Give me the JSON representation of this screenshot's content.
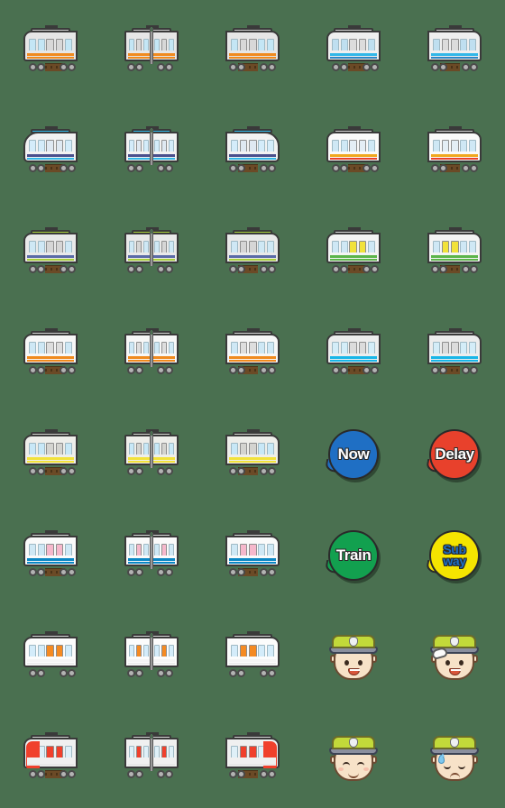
{
  "sheet": {
    "title": "Train Emoji Sticker Sheet",
    "background_color": "#4a7050",
    "columns": 5,
    "rows": 8
  },
  "palette": {
    "background": "#4a7050",
    "outline": "#3a3a3a",
    "body_silver": "#e6e6e6",
    "window_blue": "#c4e6f5",
    "rail_brown": "#6b4a26",
    "wheel_gray": "#b3b3b3",
    "orange": "#f08a1e",
    "sky_blue": "#31b7e8",
    "deep_blue": "#1f6fc4",
    "red": "#e8412c",
    "green": "#5cb54a",
    "yellow": "#f2e23a",
    "pink": "#f6b8cc",
    "cap_green": "#c2d93a",
    "skin": "#f7e2c8"
  },
  "cells": [
    {
      "id": "r1c1",
      "kind": "train",
      "name": "orange-stripe-train-front-left",
      "body": "#e6e6e6",
      "stripe": "#f08a1e",
      "stripe2": "#f08a1e",
      "roof": "#c9c9c9",
      "variant": "nose-left",
      "coupled": false,
      "door_color": "#d8d8d8",
      "window": "#c4e6f5",
      "rail": true
    },
    {
      "id": "r1c2",
      "kind": "train",
      "name": "orange-stripe-train-coupled",
      "body": "#e6e6e6",
      "stripe": "#f08a1e",
      "stripe2": "#f08a1e",
      "roof": "#c9c9c9",
      "variant": "coupled",
      "coupled": true,
      "door_color": "#d8d8d8",
      "window": "#c4e6f5",
      "rail": false
    },
    {
      "id": "r1c3",
      "kind": "train",
      "name": "orange-stripe-train-front-right",
      "body": "#e6e6e6",
      "stripe": "#f08a1e",
      "stripe2": "#f08a1e",
      "roof": "#c9c9c9",
      "variant": "nose-right",
      "coupled": false,
      "door_color": "#d8d8d8",
      "window": "#c4e6f5",
      "rail": true
    },
    {
      "id": "r1c4",
      "kind": "train",
      "name": "blue-stripe-commuter-train-left",
      "body": "#efefef",
      "stripe": "#31b7e8",
      "stripe2": "#2f86c4",
      "roof": "#cfcfcf",
      "variant": "nose-left",
      "coupled": false,
      "door_color": "#dcdcdc",
      "window": "#bfdff0",
      "rail": true
    },
    {
      "id": "r1c5",
      "kind": "train",
      "name": "blue-stripe-commuter-train-right",
      "body": "#efefef",
      "stripe": "#31b7e8",
      "stripe2": "#2f86c4",
      "roof": "#cfcfcf",
      "variant": "nose-right",
      "coupled": false,
      "door_color": "#dcdcdc",
      "window": "#bfdff0",
      "rail": true
    },
    {
      "id": "r2c1",
      "kind": "train",
      "name": "sleek-blue-roof-train-left",
      "body": "#f2f2f2",
      "stripe": "#4a4f8c",
      "stripe2": "#31b7e8",
      "roof": "#31b7e8",
      "variant": "nose-left",
      "coupled": false,
      "sleek": true,
      "door_color": "#dfe9f2",
      "window": "#d4ecfa",
      "rail": true
    },
    {
      "id": "r2c2",
      "kind": "train",
      "name": "sleek-blue-roof-train-coupled",
      "body": "#f2f2f2",
      "stripe": "#4a4f8c",
      "stripe2": "#31b7e8",
      "roof": "#31b7e8",
      "variant": "coupled",
      "coupled": true,
      "sleek": true,
      "door_color": "#dfe9f2",
      "window": "#d4ecfa",
      "rail": false
    },
    {
      "id": "r2c3",
      "kind": "train",
      "name": "sleek-blue-roof-train-right",
      "body": "#f2f2f2",
      "stripe": "#4a4f8c",
      "stripe2": "#31b7e8",
      "roof": "#31b7e8",
      "variant": "nose-right",
      "coupled": false,
      "sleek": true,
      "door_color": "#dfe9f2",
      "window": "#d4ecfa",
      "rail": true
    },
    {
      "id": "r2c4",
      "kind": "train",
      "name": "orange-red-stripe-train-left",
      "body": "#fafafa",
      "stripe": "#f0a81e",
      "stripe2": "#e8412c",
      "roof": "#d2d2d2",
      "variant": "nose-left",
      "coupled": false,
      "door_color": "#e4eef5",
      "window": "#cfe8f5",
      "rail": true
    },
    {
      "id": "r2c5",
      "kind": "train",
      "name": "orange-red-stripe-train-right",
      "body": "#fafafa",
      "stripe": "#f0a81e",
      "stripe2": "#e8412c",
      "roof": "#d2d2d2",
      "variant": "nose-right",
      "coupled": false,
      "door_color": "#e4eef5",
      "window": "#cfe8f5",
      "rail": true
    },
    {
      "id": "r3c1",
      "kind": "train",
      "name": "green-roof-suburban-train-left",
      "body": "#e9e9e9",
      "stripe": "#5a6aa8",
      "stripe2": "#a8cf3a",
      "roof": "#a8cf3a",
      "variant": "nose-left",
      "coupled": false,
      "door_color": "#d6d6d6",
      "window": "#cfe8f5",
      "rail": true
    },
    {
      "id": "r3c2",
      "kind": "train",
      "name": "green-roof-suburban-train-coupled",
      "body": "#e9e9e9",
      "stripe": "#5a6aa8",
      "stripe2": "#a8cf3a",
      "roof": "#a8cf3a",
      "variant": "coupled",
      "coupled": true,
      "door_color": "#d6d6d6",
      "window": "#cfe8f5",
      "rail": false
    },
    {
      "id": "r3c3",
      "kind": "train",
      "name": "green-roof-suburban-train-right",
      "body": "#e9e9e9",
      "stripe": "#5a6aa8",
      "stripe2": "#a8cf3a",
      "roof": "#a8cf3a",
      "variant": "nose-right",
      "coupled": false,
      "door_color": "#d6d6d6",
      "window": "#cfe8f5",
      "rail": true
    },
    {
      "id": "r3c4",
      "kind": "train",
      "name": "green-yellow-door-local-train-left",
      "body": "#f4f4f4",
      "stripe": "#5cb54a",
      "stripe2": "#5cb54a",
      "roof": "#d8d8d8",
      "variant": "nose-left",
      "coupled": false,
      "door_color": "#f2e23a",
      "window": "#cfe8f5",
      "rail": true
    },
    {
      "id": "r3c5",
      "kind": "train",
      "name": "green-yellow-door-local-train-right",
      "body": "#f4f4f4",
      "stripe": "#5cb54a",
      "stripe2": "#5cb54a",
      "roof": "#d8d8d8",
      "variant": "nose-right",
      "coupled": false,
      "door_color": "#f2e23a",
      "window": "#cfe8f5",
      "rail": true
    },
    {
      "id": "r4c1",
      "kind": "train",
      "name": "orange-line-express-train-left",
      "body": "#f7f7f7",
      "stripe": "#f08a1e",
      "stripe2": "#f08a1e",
      "roof": "#d4d4d4",
      "variant": "nose-left",
      "coupled": false,
      "door_color": "#dedede",
      "window": "#cfe8f5",
      "rail": true
    },
    {
      "id": "r4c2",
      "kind": "train",
      "name": "orange-line-express-train-coupled",
      "body": "#f7f7f7",
      "stripe": "#f08a1e",
      "stripe2": "#f08a1e",
      "roof": "#d4d4d4",
      "variant": "coupled",
      "coupled": true,
      "door_color": "#dedede",
      "window": "#cfe8f5",
      "rail": false
    },
    {
      "id": "r4c3",
      "kind": "train",
      "name": "orange-line-express-train-right",
      "body": "#f7f7f7",
      "stripe": "#f08a1e",
      "stripe2": "#f08a1e",
      "roof": "#d4d4d4",
      "variant": "nose-right",
      "coupled": false,
      "door_color": "#dedede",
      "window": "#cfe8f5",
      "rail": true
    },
    {
      "id": "r4c4",
      "kind": "train",
      "name": "cyan-stripe-train-left",
      "body": "#ededed",
      "stripe": "#18b6e8",
      "stripe2": "#18b6e8",
      "roof": "#cccccc",
      "variant": "nose-left",
      "coupled": false,
      "door_color": "#dcdcdc",
      "window": "#d4edf8",
      "rail": true
    },
    {
      "id": "r4c5",
      "kind": "train",
      "name": "cyan-stripe-train-right",
      "body": "#ededed",
      "stripe": "#18b6e8",
      "stripe2": "#18b6e8",
      "roof": "#cccccc",
      "variant": "nose-right",
      "coupled": false,
      "door_color": "#dcdcdc",
      "window": "#d4edf8",
      "rail": true
    },
    {
      "id": "r5c1",
      "kind": "train",
      "name": "yellow-stripe-train-left",
      "body": "#eeeeea",
      "stripe": "#f2e23a",
      "stripe2": "#f2e23a",
      "roof": "#d0d0cc",
      "variant": "nose-left",
      "coupled": false,
      "door_color": "#d4d4d0",
      "window": "#c8e8f7",
      "rail": true
    },
    {
      "id": "r5c2",
      "kind": "train",
      "name": "yellow-stripe-train-coupled",
      "body": "#eeeeea",
      "stripe": "#f2e23a",
      "stripe2": "#f2e23a",
      "roof": "#d0d0cc",
      "variant": "coupled",
      "coupled": true,
      "door_color": "#d4d4d0",
      "window": "#c8e8f7",
      "rail": false
    },
    {
      "id": "r5c3",
      "kind": "train",
      "name": "yellow-stripe-train-right",
      "body": "#eeeeea",
      "stripe": "#f2e23a",
      "stripe2": "#f2e23a",
      "roof": "#d0d0cc",
      "variant": "nose-right",
      "coupled": false,
      "door_color": "#d4d4d0",
      "window": "#c8e8f7",
      "rail": true
    },
    {
      "id": "r5c4",
      "kind": "badge",
      "name": "now-badge",
      "label": "Now",
      "fill": "#1f6fc4",
      "text_color": "#ffffff",
      "lines": 1
    },
    {
      "id": "r5c5",
      "kind": "badge",
      "name": "delay-badge",
      "label": "Delay",
      "fill": "#e8412c",
      "text_color": "#ffffff",
      "lines": 1
    },
    {
      "id": "r6c1",
      "kind": "train",
      "name": "pink-door-train-left",
      "body": "#fafafa",
      "stripe": "#0a86c4",
      "stripe2": "#0a86c4",
      "roof": "#d8d8d8",
      "variant": "nose-left",
      "coupled": false,
      "door_color": "#f6b8cc",
      "window": "#cfe8f5",
      "rail": true
    },
    {
      "id": "r6c2",
      "kind": "train",
      "name": "pink-door-train-coupled",
      "body": "#fafafa",
      "stripe": "#0a86c4",
      "stripe2": "#0a86c4",
      "roof": "#d8d8d8",
      "variant": "coupled",
      "coupled": true,
      "door_color": "#f6b8cc",
      "window": "#cfe8f5",
      "rail": false
    },
    {
      "id": "r6c3",
      "kind": "train",
      "name": "pink-door-train-right",
      "body": "#fafafa",
      "stripe": "#0a86c4",
      "stripe2": "#0a86c4",
      "roof": "#d8d8d8",
      "variant": "nose-right",
      "coupled": false,
      "door_color": "#f6b8cc",
      "window": "#cfe8f5",
      "rail": true
    },
    {
      "id": "r6c4",
      "kind": "badge",
      "name": "train-badge",
      "label": "Train",
      "fill": "#12a04f",
      "text_color": "#ffffff",
      "lines": 1
    },
    {
      "id": "r6c5",
      "kind": "badge",
      "name": "subway-badge",
      "label": "Sub way",
      "label_line1": "Sub",
      "label_line2": "way",
      "fill": "#f5e400",
      "text_color": "#1f6fc4",
      "lines": 2
    },
    {
      "id": "r7c1",
      "kind": "train",
      "name": "orange-door-train-left",
      "body": "#fcfcfc",
      "stripe": "#f5f5f5",
      "stripe2": "#ededed",
      "roof": "#d6d6d6",
      "variant": "nose-left",
      "coupled": false,
      "door_color": "#f58a22",
      "window": "#d4ecfa",
      "rail": false
    },
    {
      "id": "r7c2",
      "kind": "train",
      "name": "orange-door-train-coupled",
      "body": "#fcfcfc",
      "stripe": "#f5f5f5",
      "stripe2": "#ededed",
      "roof": "#d6d6d6",
      "variant": "coupled",
      "coupled": true,
      "door_color": "#f58a22",
      "window": "#d4ecfa",
      "rail": false
    },
    {
      "id": "r7c3",
      "kind": "train",
      "name": "orange-door-train-right",
      "body": "#fcfcfc",
      "stripe": "#f5f5f5",
      "stripe2": "#ededed",
      "roof": "#d6d6d6",
      "variant": "nose-right",
      "coupled": false,
      "door_color": "#f58a22",
      "window": "#d4ecfa",
      "rail": false
    },
    {
      "id": "r7c4",
      "kind": "face",
      "name": "conductor-smiling-face",
      "expression": "smiling",
      "cap_color": "#c2d93a",
      "skin": "#f7e2c8"
    },
    {
      "id": "r7c5",
      "kind": "face",
      "name": "conductor-saluting-face",
      "expression": "saluting",
      "cap_color": "#c2d93a",
      "skin": "#f7e2c8"
    },
    {
      "id": "r8c1",
      "kind": "train",
      "name": "red-front-diesel-car-left",
      "body": "#f0f0f0",
      "stripe": "#f0f0f0",
      "stripe2": "#e8e8e8",
      "roof": "#d2d2d2",
      "variant": "nose-left",
      "coupled": false,
      "door_color": "#f0402c",
      "window": "#dff0f8",
      "rail": true,
      "nose_block": "#f0402c"
    },
    {
      "id": "r8c2",
      "kind": "train",
      "name": "red-door-diesel-car-coupled",
      "body": "#f0f0f0",
      "stripe": "#f0f0f0",
      "stripe2": "#e8e8e8",
      "roof": "#d2d2d2",
      "variant": "coupled",
      "coupled": true,
      "door_color": "#f0402c",
      "window": "#dff0f8",
      "rail": false
    },
    {
      "id": "r8c3",
      "kind": "train",
      "name": "red-front-diesel-car-right",
      "body": "#f0f0f0",
      "stripe": "#f0f0f0",
      "stripe2": "#e8e8e8",
      "roof": "#d2d2d2",
      "variant": "nose-right",
      "coupled": false,
      "door_color": "#f0402c",
      "window": "#dff0f8",
      "rail": true,
      "nose_block": "#f0402c"
    },
    {
      "id": "r8c4",
      "kind": "face",
      "name": "conductor-happy-closed-eyes-face",
      "expression": "happy-closed",
      "cap_color": "#c2d93a",
      "skin": "#f7e2c8"
    },
    {
      "id": "r8c5",
      "kind": "face",
      "name": "conductor-worried-sweating-face",
      "expression": "worried-sweat",
      "cap_color": "#c2d93a",
      "skin": "#f7e2c8"
    }
  ]
}
